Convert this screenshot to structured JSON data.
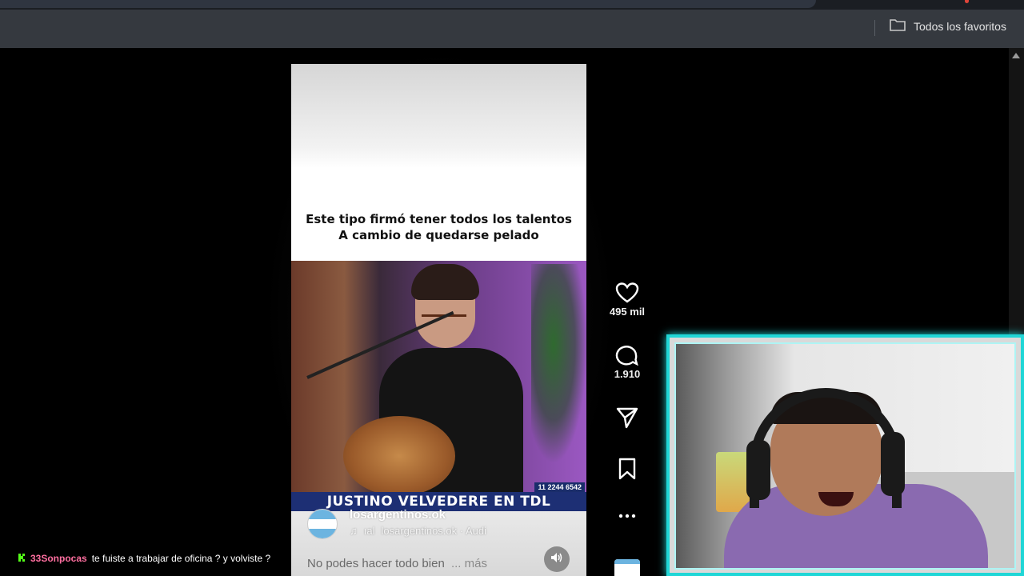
{
  "browser": {
    "bookmarks_folder_label": "Todos los favoritos"
  },
  "video": {
    "caption_line1": "Este tipo firmó tener todos los talentos",
    "caption_line2": "A cambio de quedarse pelado",
    "phone_number": "11 2244 6542",
    "banner_text": "JUSTINO VELVEDERE EN TDL",
    "username": "losargentinos.ok",
    "audio_prefix": "ıal",
    "audio_text": "losargentinos.ok · Audi",
    "description": "No podes hacer todo bien",
    "more_label": "... más"
  },
  "actions": {
    "likes": "495 mil",
    "comments": "1.910"
  },
  "chat": {
    "username": "33Sonpocas",
    "message": "te fuiste a trabajar de oficina ? y volviste ?"
  },
  "colors": {
    "webcam_border": "#20d6d6",
    "banner_bg": "#1d2f74",
    "chat_username": "#ff6fa0"
  }
}
